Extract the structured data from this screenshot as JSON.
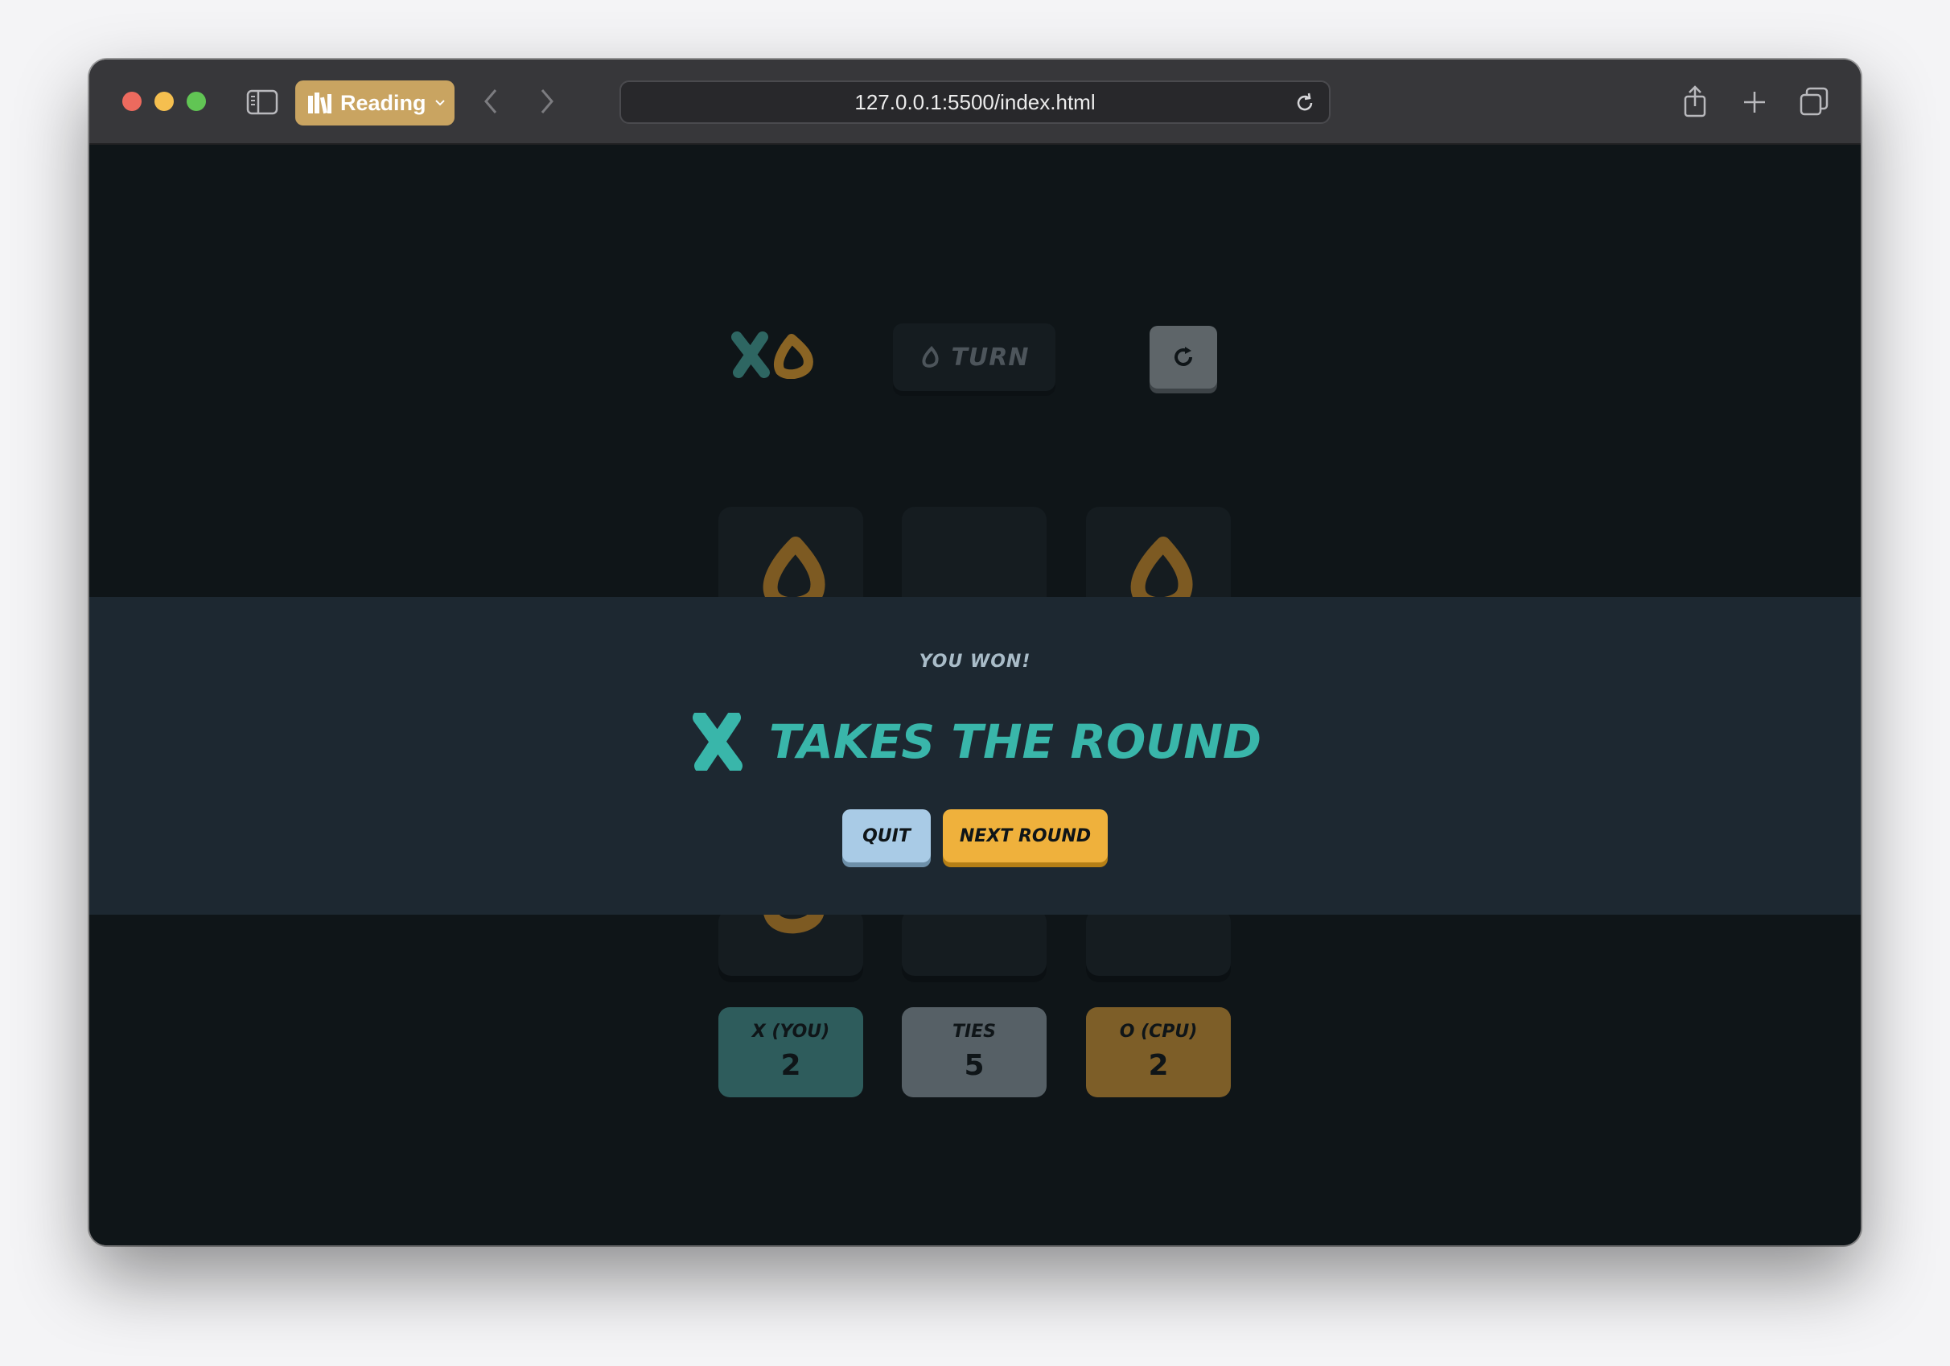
{
  "browser": {
    "reading_label": "Reading",
    "url": "127.0.0.1:5500/index.html"
  },
  "game": {
    "turn_text": "TURN",
    "turn_mark": "O",
    "restart_icon": "restart-icon",
    "board": [
      "O",
      "",
      "O",
      "",
      "",
      "",
      "O",
      "",
      ""
    ]
  },
  "modal": {
    "subtitle": "YOU WON!",
    "title": "TAKES THE ROUND",
    "winner_mark": "X",
    "quit_label": "QUIT",
    "next_label": "NEXT ROUND"
  },
  "scores": {
    "x_label": "X (YOU)",
    "x_value": "2",
    "ties_label": "TIES",
    "ties_value": "5",
    "o_label": "O (CPU)",
    "o_value": "2"
  },
  "colors": {
    "x": "#39b6aa",
    "o": "#efb13c",
    "modal_bg": "#1d2831"
  }
}
